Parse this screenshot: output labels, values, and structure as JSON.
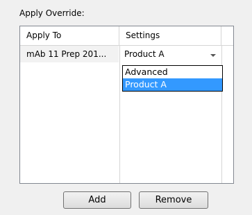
{
  "section_label": "Apply Override:",
  "grid": {
    "columns": [
      "Apply To",
      "Settings"
    ],
    "rows": [
      {
        "apply_to": "mAb 11 Prep 201...",
        "settings": "Product A"
      }
    ]
  },
  "dropdown": {
    "options": [
      "Advanced",
      "Product A"
    ],
    "selected": "Product A",
    "arrow_icon": "dropdown-arrow-icon"
  },
  "buttons": {
    "add": "Add",
    "remove": "Remove"
  },
  "colors": {
    "selection": "#3399ff",
    "background": "#f0f0f0"
  }
}
